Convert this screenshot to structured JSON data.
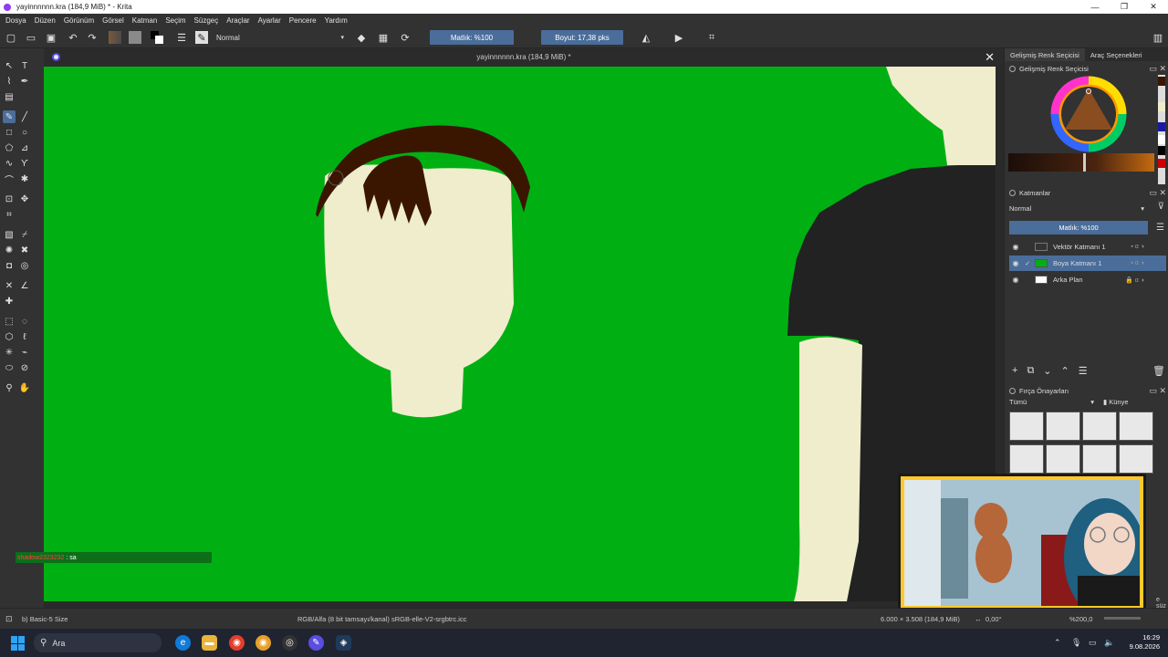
{
  "window": {
    "title": "yayinnnnnn.kra (184,9 MiB) * - Krita",
    "controls": [
      "—",
      "❐",
      "✕"
    ]
  },
  "menu": [
    "Dosya",
    "Düzen",
    "Görünüm",
    "Görsel",
    "Katman",
    "Seçim",
    "Süzgeç",
    "Araçlar",
    "Ayarlar",
    "Pencere",
    "Yardım"
  ],
  "toolbar": {
    "blend_mode": "Normal",
    "opacity_label": "Matlık: %100",
    "size_label": "Boyut: 17,38 pks"
  },
  "document": {
    "tab_title": "yayinnnnnn.kra (184,9 MiB) *",
    "close_glyph": "✕"
  },
  "chat": {
    "user": "shadow2323232",
    "message": ": sa"
  },
  "dock": {
    "tabs": [
      "Gelişmiş Renk Seçicisi",
      "Araç Seçenekleri"
    ],
    "color_selector_title": "Gelişmiş Renk Seçicisi",
    "layers_title": "Katmanlar",
    "layers_blend": "Normal",
    "layers_opacity": "Matlık: %100",
    "layers": [
      {
        "name": "Vektör Katmanı 1",
        "selected": false
      },
      {
        "name": "Boya Katmanı 1",
        "selected": true
      },
      {
        "name": "Arka Plan",
        "selected": false
      }
    ],
    "brush_presets_title": "Fırça Önayarları",
    "brush_filter": "Tümü",
    "brush_tag": "Künye",
    "brush_search_hint": "e süz"
  },
  "status": {
    "brush_name": "b) Basic-5 Size",
    "color_profile": "RGB/Alfa (8 bit tamsayı/kanal) sRGB-elle-V2-srgbtrc.icc",
    "dimensions": "6.000 × 3.508 (184,9 MiB)",
    "rotation": "0,00°",
    "zoom": "%200,0"
  },
  "taskbar": {
    "search_placeholder": "Ara",
    "time": "16:29",
    "date": "9.08.2026"
  },
  "colors": {
    "canvas_green": "#00b013",
    "skin": "#f0edcd",
    "hair": "#3a1600",
    "shirt": "#222222",
    "accent": "#4a6d9a"
  }
}
